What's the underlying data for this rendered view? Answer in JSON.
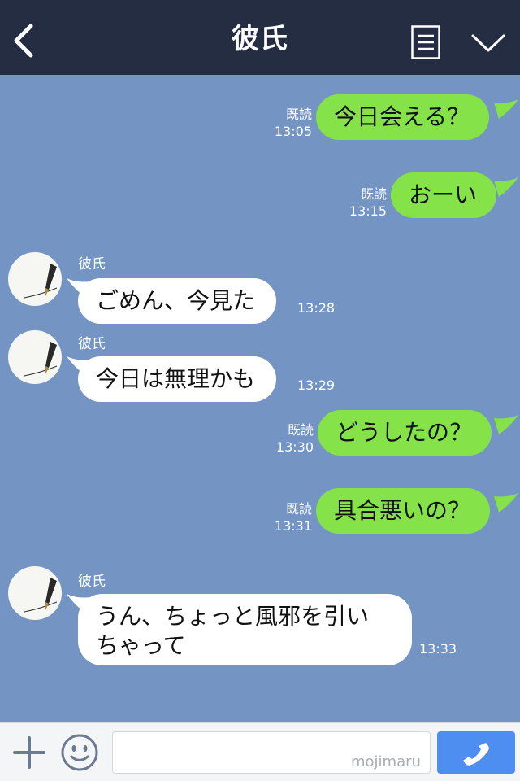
{
  "header": {
    "title": "彼氏",
    "icons": {
      "back": "chevron-left-icon",
      "menu": "list-menu-icon",
      "collapse": "chevron-down-icon"
    }
  },
  "messages": [
    {
      "dir": "out",
      "text": "今日会える？",
      "read": "既読",
      "time": "13:05"
    },
    {
      "dir": "out",
      "text": "おーい",
      "read": "既読",
      "time": "13:15"
    },
    {
      "dir": "in",
      "sender": "彼氏",
      "text": "ごめん、今見た",
      "time": "13:28"
    },
    {
      "dir": "in",
      "sender": "彼氏",
      "text": "今日は無理かも",
      "time": "13:29"
    },
    {
      "dir": "out",
      "text": "どうしたの？",
      "read": "既読",
      "time": "13:30"
    },
    {
      "dir": "out",
      "text": "具合悪いの？",
      "read": "既読",
      "time": "13:31"
    },
    {
      "dir": "in",
      "sender": "彼氏",
      "text_line1": "うん、ちょっと風邪を引い",
      "text_line2": "ちゃって",
      "time": "13:33"
    }
  ],
  "input_bar": {
    "placeholder": "",
    "watermark": "mojimaru",
    "icons": {
      "plus": "plus-icon",
      "emoji": "smiley-icon",
      "call": "phone-icon"
    }
  },
  "colors": {
    "header_bg": "#242d42",
    "chat_bg": "#7495c4",
    "outgoing_bubble": "#85e249",
    "incoming_bubble": "#ffffff",
    "call_button": "#4f8ef1"
  }
}
